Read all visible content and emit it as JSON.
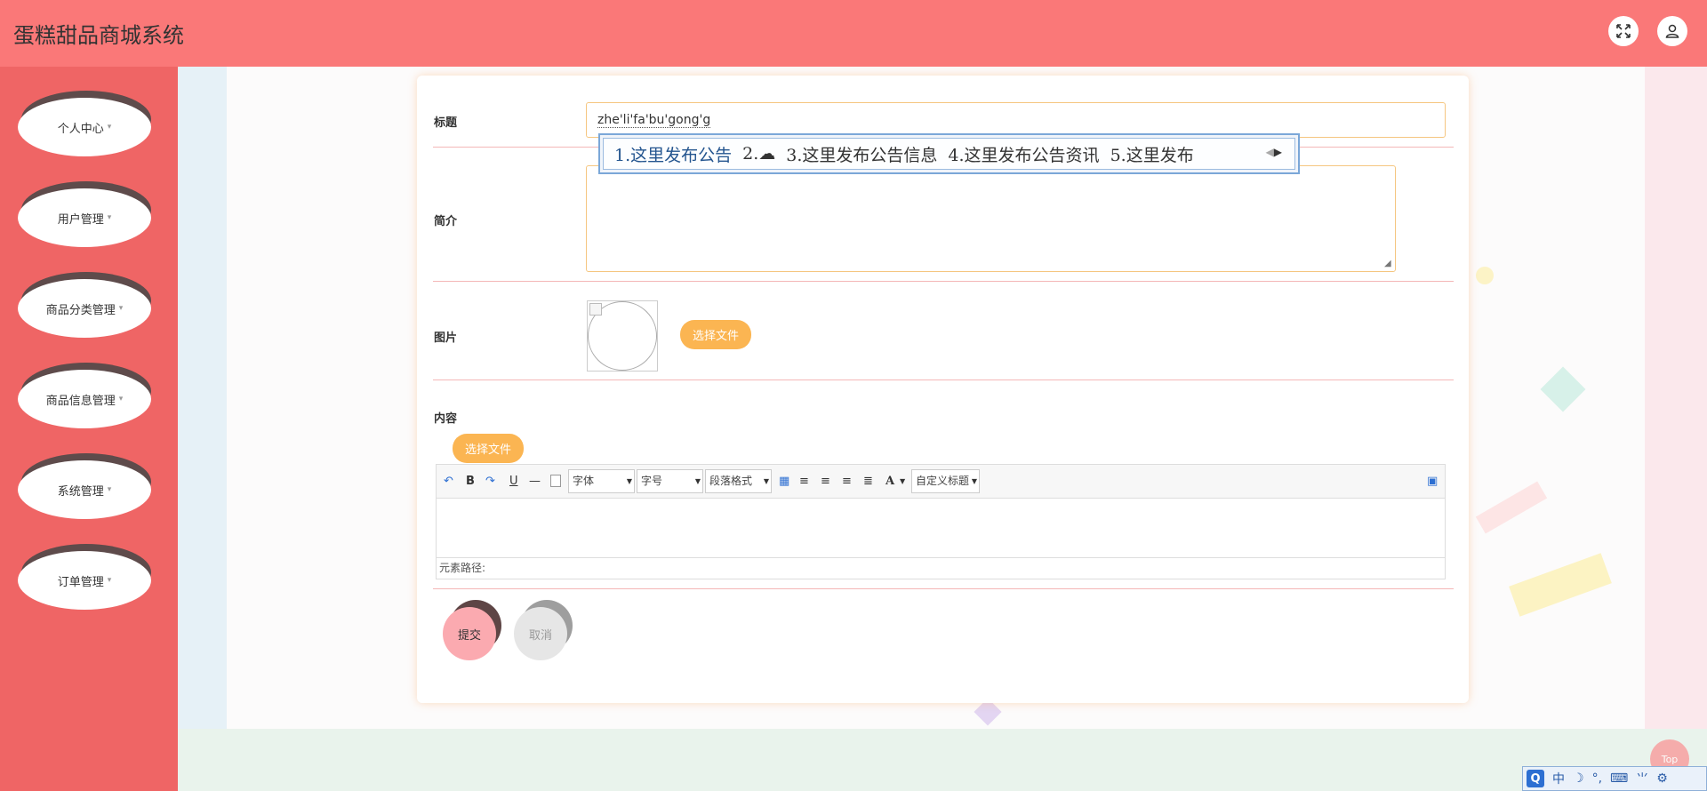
{
  "header": {
    "app_title": "蛋糕甜品商城系统",
    "expand_icon": "fullscreen-icon",
    "user_icon": "user-icon"
  },
  "sidebar": {
    "items": [
      {
        "label": "个人中心"
      },
      {
        "label": "用户管理"
      },
      {
        "label": "商品分类管理"
      },
      {
        "label": "商品信息管理"
      },
      {
        "label": "系统管理"
      },
      {
        "label": "订单管理"
      }
    ],
    "caret": "▾"
  },
  "form": {
    "title_label": "标题",
    "title_value": "zhe'li'fa'bu'gong'g",
    "intro_label": "简介",
    "image_label": "图片",
    "image_upload_label": "选择文件",
    "content_label": "内容",
    "content_upload_label": "选择文件",
    "submit_label": "提交",
    "cancel_label": "取消"
  },
  "editor": {
    "font_family_select": "字体",
    "font_size_select": "字号",
    "paragraph_select": "段落格式",
    "custom_title_select": "自定义标题",
    "element_path_label": "元素路径:",
    "tools": {
      "undo": "↶",
      "bold": "B",
      "redo": "↷",
      "underline": "U",
      "hr": "—",
      "font_color": "A"
    }
  },
  "ime_popup": {
    "candidates": [
      "1.这里发布公告",
      "2.☁",
      "3.这里发布公告信息",
      "4.这里发布公告资讯",
      "5.这里发布"
    ]
  },
  "top_button_label": "Top",
  "ime_tray": {
    "logo": "Q",
    "mode": "中",
    "items": [
      "☽",
      "°,",
      "⌨",
      "⺌",
      "⚙"
    ]
  },
  "colors": {
    "header_bg": "#fa7878",
    "sidebar_bg": "#ef6565",
    "accent_orange": "#fbb552",
    "submit_pink": "#fbaab0"
  }
}
